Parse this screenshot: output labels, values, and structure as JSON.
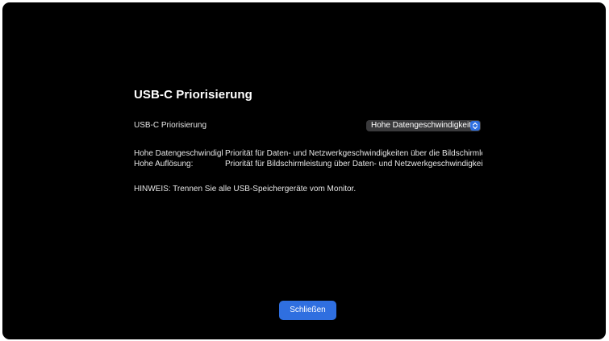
{
  "dialog": {
    "title": "USB-C Priorisierung",
    "setting_label": "USB-C Priorisierung",
    "popup": {
      "selected": "Hohe Datengeschwindigkeit",
      "icon": "chevron-up-down-icon",
      "accent_color": "#2f6fe0"
    },
    "descriptions": [
      {
        "key": "Hohe Datengeschwindigkeit:",
        "value": "Priorität für Daten- und Netzwerkgeschwindigkeiten über die Bildschirmleistung."
      },
      {
        "key": "Hohe Auflösung:",
        "value": "Priorität für Bildschirmleistung über Daten- und Netzwerkgeschwindigkeit."
      }
    ],
    "note": "HINWEIS: Trennen Sie alle USB-Speichergeräte vom Monitor.",
    "close_label": "Schließen"
  }
}
